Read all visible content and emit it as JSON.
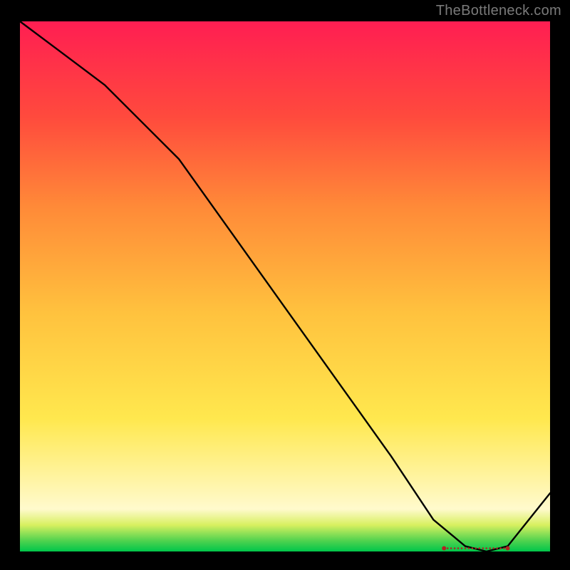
{
  "watermark": "TheBottleneck.com",
  "marker": {
    "label": ""
  },
  "colors": {
    "curve": "#000000",
    "marker": "#B22222",
    "gradient_top": "#ff1e52",
    "gradient_bottom": "#00c64a"
  },
  "chart_data": {
    "type": "line",
    "title": "",
    "xlabel": "",
    "ylabel": "",
    "xlim": [
      0,
      100
    ],
    "ylim": [
      0,
      100
    ],
    "x": [
      0,
      8,
      16,
      24,
      30,
      40,
      50,
      60,
      70,
      78,
      84,
      88,
      92,
      100
    ],
    "y": [
      100,
      94,
      88,
      80,
      74,
      60,
      46,
      32,
      18,
      6,
      1,
      0,
      1,
      11
    ],
    "marker_region": {
      "x_start": 80,
      "x_end": 92,
      "y": 0.6,
      "label": ""
    }
  }
}
